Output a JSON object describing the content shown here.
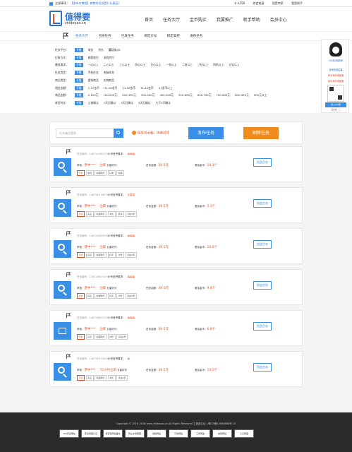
{
  "topbar": {
    "notice_label": "注意事项：",
    "notice_text": "【发布方教程】做错的任务是什么原因？",
    "balance": "卡卡258",
    "links": [
      "收信链接",
      "我是商家",
      "我是刷手"
    ]
  },
  "header": {
    "logo_name": "值得要",
    "logo_domain": "zhideyao.cn",
    "nav": [
      "首页",
      "任务大厅",
      "金币购买",
      "我要推广",
      "新手帮助",
      "会员中心"
    ]
  },
  "subnav": {
    "items": [
      "任务大厅",
      "已接任务",
      "已发任务",
      "绑定买号",
      "绑定掌柜",
      "发布任务"
    ]
  },
  "filters": [
    {
      "label": "任务平台：",
      "options": [
        "不限",
        "淘宝",
        "京东",
        "蘑菇街/JD"
      ]
    },
    {
      "label": "付款方式：",
      "options": [
        "不限",
        "威客垫付",
        "流程代付"
      ]
    },
    {
      "label": "最低要求：",
      "options": [
        "不限",
        "一心以上",
        "二心以上",
        "三心以上",
        "四心以上",
        "五心以上",
        "一钻以上",
        "二钻以上",
        "三钻以上",
        "四钻以上",
        "五钻以上"
      ]
    },
    {
      "label": "任务类型：",
      "options": [
        "不限",
        "手机任务",
        "电脑任务"
      ]
    },
    {
      "label": "商品类型：",
      "options": [
        "不限",
        "虚拟商品",
        "实物商品"
      ]
    },
    {
      "label": "佣金金额：",
      "options": [
        "不限",
        "1-10金币",
        "11-20金币",
        "21-30金币",
        "31-40金币",
        "41金币以上"
      ]
    },
    {
      "label": "商品金额：",
      "options": [
        "不限",
        "0-100元",
        "100-200元",
        "200-300元",
        "300-400元",
        "400-500元",
        "500-600元",
        "600-700元",
        "700-800元",
        "800-900元",
        "900元以上"
      ]
    },
    {
      "label": "收货时长：",
      "options": [
        "不限",
        "立刻确认",
        "1天后确认",
        "2天后确认",
        "3天后确认",
        "大于4天确认"
      ]
    }
  ],
  "search": {
    "placeholder": "任务编号搜索",
    "tip": "接任务必看，违者封号",
    "publish_label": "发布任务",
    "claim_label": "刷新任务"
  },
  "cards": [
    {
      "id": "任务编号：1467244820791",
      "req_label": "小号信誉要求：",
      "req_value": "每每每",
      "shop_label": "掌柜：",
      "shop_name": "梦中***",
      "time": "立即",
      "review": "五星好评",
      "amount_label": "任务金额：",
      "amount": "39.5元",
      "gold_label": "悬赏金币：",
      "gold": "10.3个",
      "tags": [
        "手机",
        "金钱",
        "收藏聊天",
        "好收",
        "收藏"
      ],
      "grab": "抢此任务",
      "icon": "search"
    },
    {
      "id": "任务编号：1467284768750",
      "req_label": "小号信誉要求：",
      "req_value": "无要求",
      "shop_label": "掌柜：",
      "shop_name": "梦中***",
      "time": "立即",
      "review": "五星好评",
      "amount_label": "任务金额：",
      "amount": "39.5元",
      "gold_label": "悬赏金币：",
      "gold": "5.3个",
      "tags": [
        "手机",
        "实名",
        "收藏聊天",
        "浏览",
        "假货",
        "双拍1家"
      ],
      "grab": "抢此任务",
      "icon": "search"
    },
    {
      "id": "任务编号：1467265689789",
      "req_label": "小号信誉要求：",
      "req_value": "每每每",
      "shop_label": "掌柜：",
      "shop_name": "梦中***",
      "time": "立即",
      "review": "五星好评",
      "amount_label": "任务金额：",
      "amount": "39.5元",
      "gold_label": "悬赏金币：",
      "gold": "10.6个",
      "tags": [
        "手机",
        "实名",
        "收藏聊天",
        "好评",
        "浏览",
        "双拍1家"
      ],
      "grab": "抢此任务",
      "icon": "search"
    },
    {
      "id": "任务编号：1467266194749",
      "req_label": "小号信誉要求：",
      "req_value": "每每每",
      "shop_label": "掌柜：",
      "shop_name": "梦中***",
      "time": "立即",
      "review": "五星好评",
      "amount_label": "任务金额：",
      "amount": "39.5元",
      "gold_label": "悬赏金币：",
      "gold": "9.8个",
      "tags": [
        "手机",
        "实名",
        "收藏聊天",
        "好评",
        "浏览",
        "双拍1家"
      ],
      "grab": "抢此任务",
      "icon": "search"
    },
    {
      "id": "任务编号：1467266053747",
      "req_label": "小号信誉要求：",
      "req_value": "每每每",
      "shop_label": "掌柜：",
      "shop_name": "梦中***",
      "time": "立即",
      "review": "五星好评",
      "amount_label": "任务金额：",
      "amount": "39.5元",
      "gold_label": "悬赏金币：",
      "gold": "6.8个",
      "tags": [
        "手机",
        "实名",
        "收藏聊天",
        "浏览",
        "双拍1家"
      ],
      "grab": "抢此任务",
      "icon": "gift"
    },
    {
      "id": "任务编号：1467265708756",
      "req_label": "小号信誉要求：",
      "req_value": "每",
      "shop_label": "掌柜：",
      "shop_name": "梦中***",
      "time": "72小时立即",
      "review": "五星好评",
      "amount_label": "任务金额：",
      "amount": "39.5元",
      "gold_label": "悬赏金币：",
      "gold": "13.1个",
      "tags": [
        "手机",
        "实名",
        "收藏聊天",
        "浏览",
        "双拍1家"
      ],
      "grab": "抢此任务",
      "icon": "search"
    }
  ],
  "qq_panel": {
    "title": "QQ在线咨询",
    "line1": "咨询有奖招募",
    "line2": "新手和商家客服",
    "line3": "接手和商家客服",
    "qr_label": "加入QQ群",
    "social": "微博  ⓘ"
  },
  "footer": {
    "copyright": "Copyright © 2014-2016 www.zhideyao.cn All Rights Reserved 工信部认证 | 粤ICP备15888888号-10",
    "badges": [
      "360安全网站",
      "安全联盟认证",
      "经营性网站备案",
      "网上交易保障",
      "诚信网站",
      "可信网站",
      "工商网监",
      "信用网站",
      "认证联盟"
    ]
  },
  "colors": {
    "accent": "#3a8ee6",
    "red": "#e54d26",
    "orange": "#f08c1d"
  }
}
